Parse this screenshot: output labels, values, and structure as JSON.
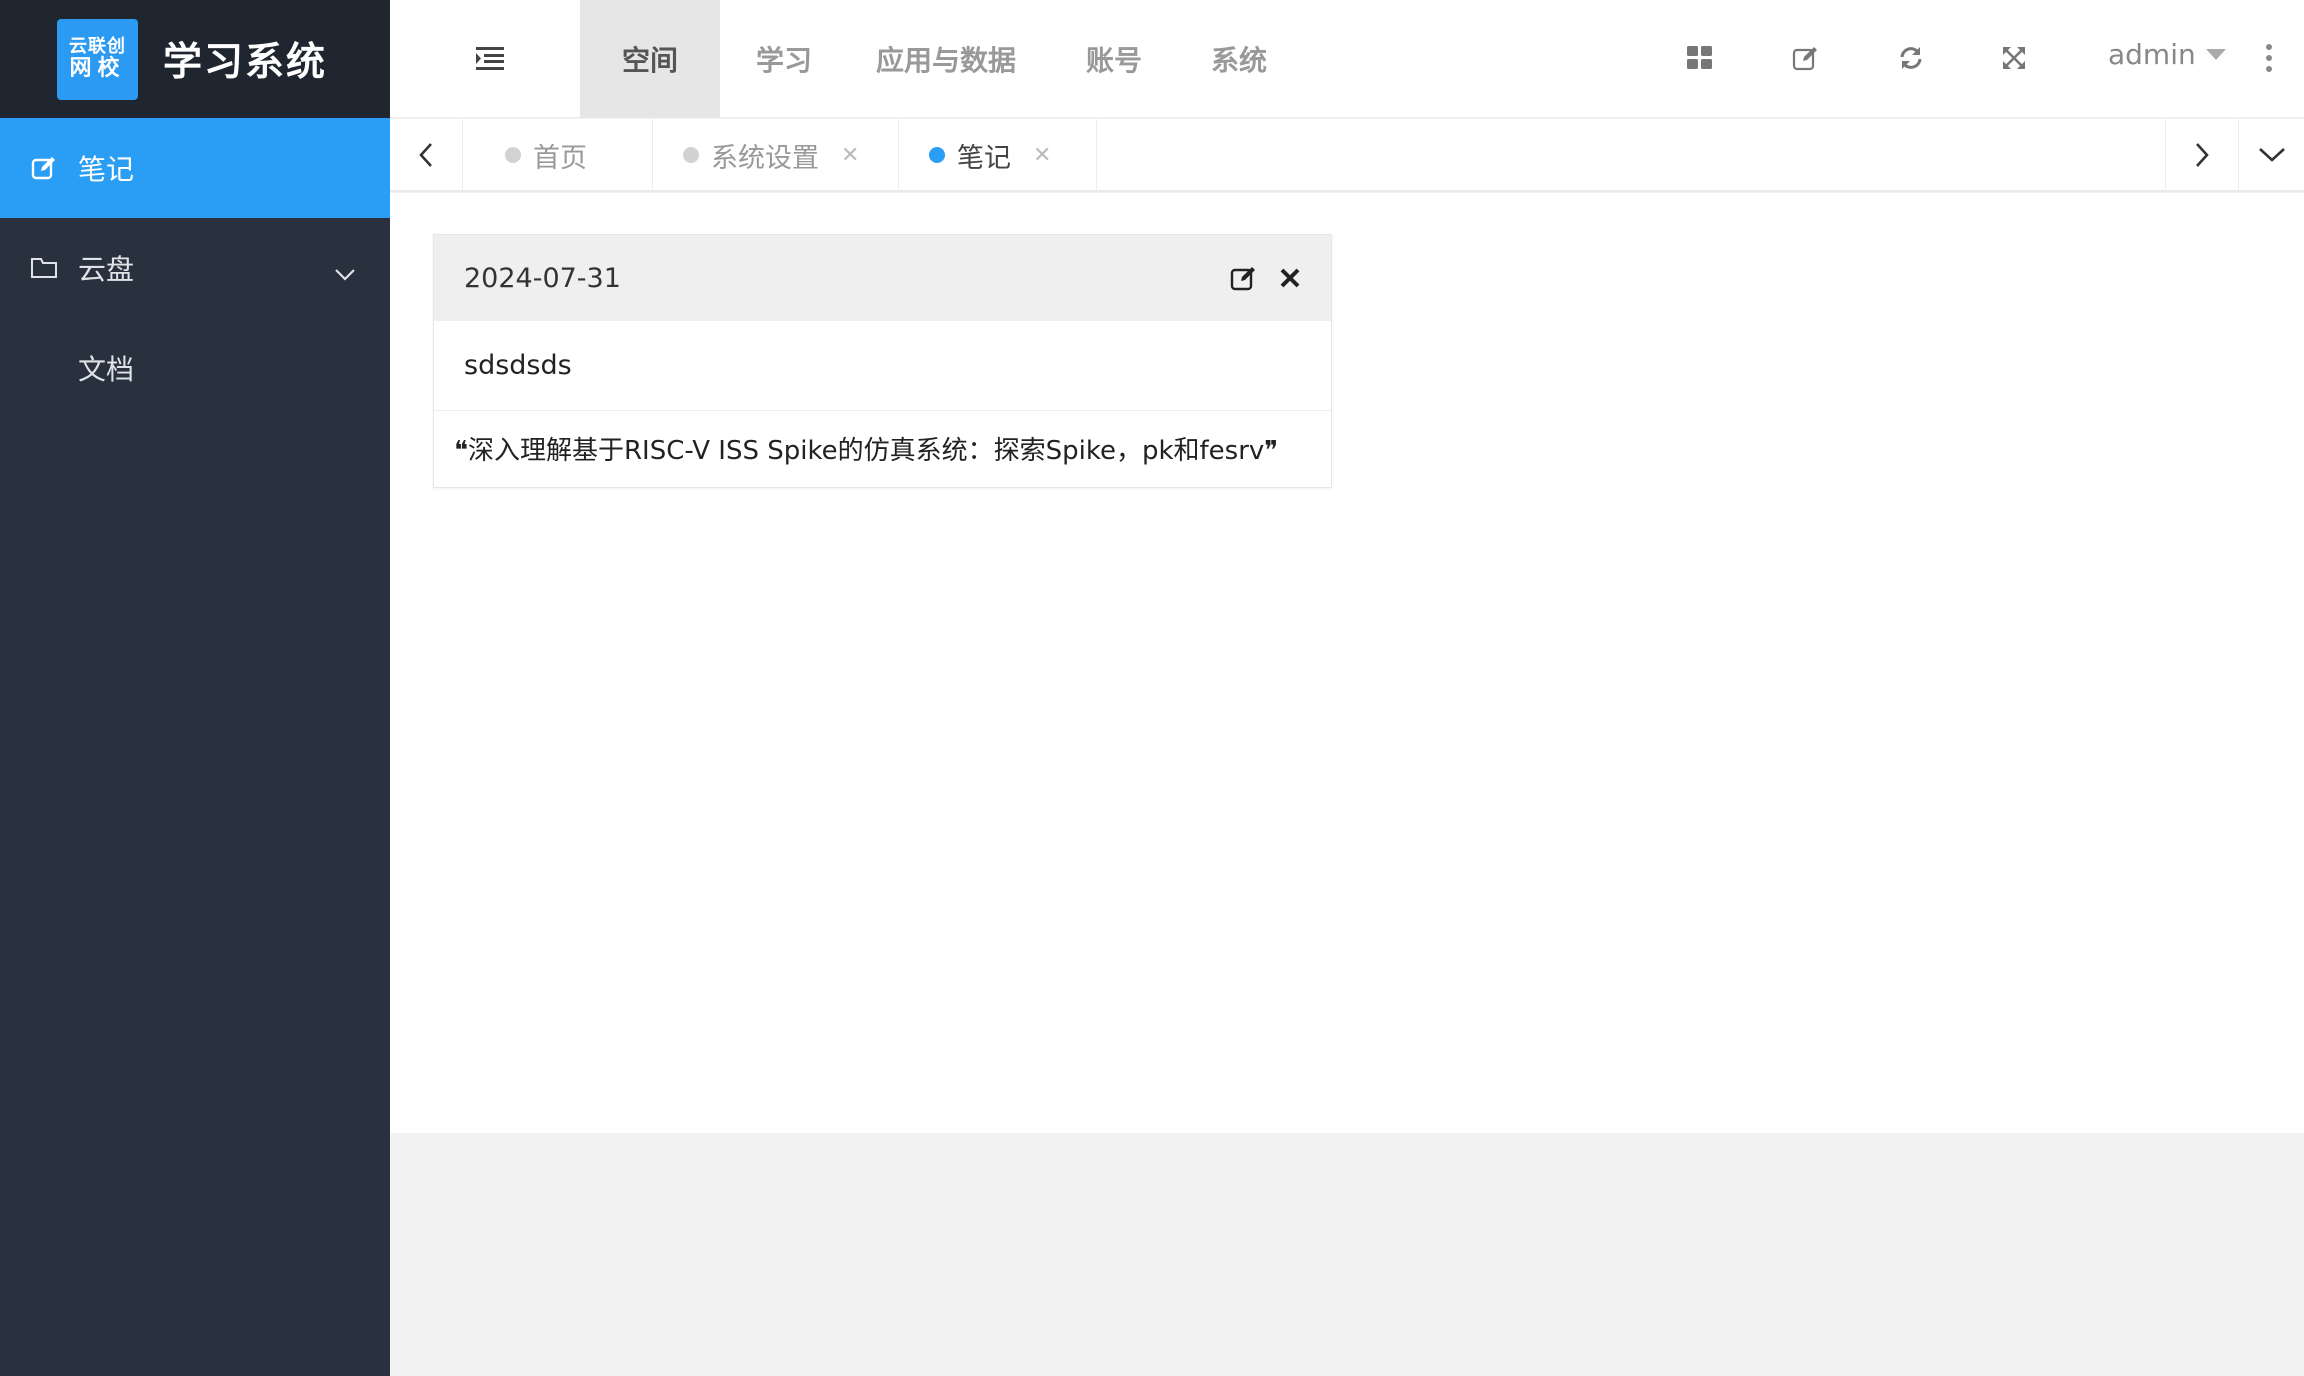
{
  "logo": {
    "line1": "云联创",
    "line2": "网校"
  },
  "app_title": "学习系统",
  "sidebar": {
    "items": [
      {
        "label": "笔记",
        "icon": "edit-icon",
        "active": true
      },
      {
        "label": "云盘",
        "icon": "folder-icon",
        "expanded": true,
        "children": [
          {
            "label": "文档"
          }
        ]
      }
    ]
  },
  "header": {
    "tabs": [
      {
        "label": "空间",
        "active": true
      },
      {
        "label": "学习"
      },
      {
        "label": "应用与数据"
      },
      {
        "label": "账号"
      },
      {
        "label": "系统"
      }
    ],
    "icons": [
      "grid-icon",
      "edit-icon",
      "refresh-icon",
      "fullscreen-icon",
      "more-vertical-icon"
    ],
    "user": "admin"
  },
  "page_tabs": [
    {
      "label": "首页",
      "closable": false,
      "active": false
    },
    {
      "label": "系统设置",
      "closable": true,
      "active": false
    },
    {
      "label": "笔记",
      "closable": true,
      "active": true
    }
  ],
  "note_card": {
    "date": "2024-07-31",
    "title": "sdsdsds",
    "content": "❝深入理解基于RISC-V ISS Spike的仿真系统：探索Spike，pk和fesrv❞"
  },
  "colors": {
    "accent": "#2a9df4",
    "sidebar": "#28313d",
    "logo_bg": "#1f2630"
  }
}
